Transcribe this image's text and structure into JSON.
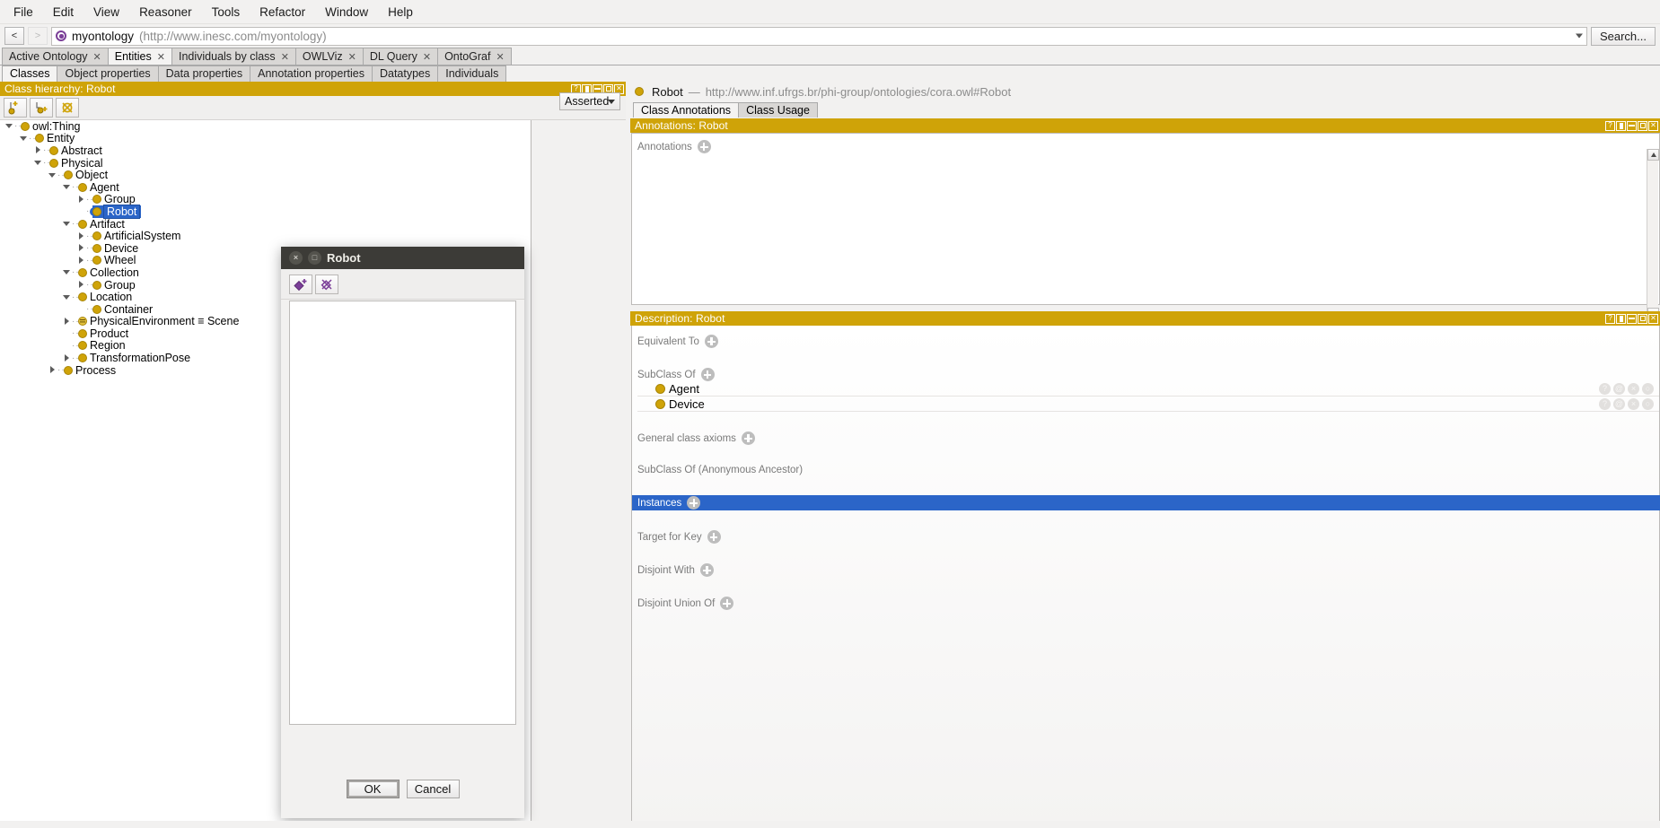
{
  "menubar": {
    "items": [
      {
        "label": "File"
      },
      {
        "label": "Edit"
      },
      {
        "label": "View"
      },
      {
        "label": "Reasoner"
      },
      {
        "label": "Tools"
      },
      {
        "label": "Refactor"
      },
      {
        "label": "Window"
      },
      {
        "label": "Help"
      }
    ]
  },
  "iribar": {
    "back_label": "<",
    "forward_label": ">",
    "ontology_name": "myontology",
    "ontology_iri": "(http://www.inesc.com/myontology)",
    "search_label": "Search...",
    "ontology_dot_color": "#7b3f98"
  },
  "workspace_tabs": [
    {
      "label": "Active Ontology",
      "active": false
    },
    {
      "label": "Entities",
      "active": true
    },
    {
      "label": "Individuals by class",
      "active": false
    },
    {
      "label": "OWLViz",
      "active": false
    },
    {
      "label": "DL Query",
      "active": false
    },
    {
      "label": "OntoGraf",
      "active": false
    }
  ],
  "category_tabs": [
    {
      "label": "Classes",
      "active": true
    },
    {
      "label": "Object properties",
      "active": false
    },
    {
      "label": "Data properties",
      "active": false
    },
    {
      "label": "Annotation properties",
      "active": false
    },
    {
      "label": "Datatypes",
      "active": false
    },
    {
      "label": "Individuals",
      "active": false
    }
  ],
  "class_hierarchy": {
    "title": "Class hierarchy: Robot",
    "toolbar": [
      {
        "name": "add-subclass-icon"
      },
      {
        "name": "add-sibling-class-icon"
      },
      {
        "name": "delete-class-icon"
      }
    ],
    "view_selector": "Asserted",
    "nodes": [
      {
        "label": "owl:Thing",
        "depth": 0,
        "twist": "down",
        "selected": false,
        "equivalent": false
      },
      {
        "label": "Entity",
        "depth": 1,
        "twist": "down",
        "selected": false,
        "equivalent": false
      },
      {
        "label": "Abstract",
        "depth": 2,
        "twist": "right",
        "selected": false,
        "equivalent": false
      },
      {
        "label": "Physical",
        "depth": 2,
        "twist": "down",
        "selected": false,
        "equivalent": false
      },
      {
        "label": "Object",
        "depth": 3,
        "twist": "down",
        "selected": false,
        "equivalent": false
      },
      {
        "label": "Agent",
        "depth": 4,
        "twist": "down",
        "selected": false,
        "equivalent": false
      },
      {
        "label": "Group",
        "depth": 5,
        "twist": "right",
        "selected": false,
        "equivalent": false
      },
      {
        "label": "Robot",
        "depth": 5,
        "twist": "leaf",
        "selected": true,
        "equivalent": false
      },
      {
        "label": "Artifact",
        "depth": 4,
        "twist": "down",
        "selected": false,
        "equivalent": false
      },
      {
        "label": "ArtificialSystem",
        "depth": 5,
        "twist": "right",
        "selected": false,
        "equivalent": false
      },
      {
        "label": "Device",
        "depth": 5,
        "twist": "right",
        "selected": false,
        "equivalent": false
      },
      {
        "label": "Wheel",
        "depth": 5,
        "twist": "right",
        "selected": false,
        "equivalent": false
      },
      {
        "label": "Collection",
        "depth": 4,
        "twist": "down",
        "selected": false,
        "equivalent": false
      },
      {
        "label": "Group",
        "depth": 5,
        "twist": "right",
        "selected": false,
        "equivalent": false
      },
      {
        "label": "Location",
        "depth": 4,
        "twist": "down",
        "selected": false,
        "equivalent": false
      },
      {
        "label": "Container",
        "depth": 5,
        "twist": "leaf",
        "selected": false,
        "equivalent": false
      },
      {
        "label": "PhysicalEnvironment ≡ Scene",
        "depth": 4,
        "twist": "right",
        "selected": false,
        "equivalent": true
      },
      {
        "label": "Product",
        "depth": 4,
        "twist": "leaf",
        "selected": false,
        "equivalent": false
      },
      {
        "label": "Region",
        "depth": 4,
        "twist": "leaf",
        "selected": false,
        "equivalent": false
      },
      {
        "label": "TransformationPose",
        "depth": 4,
        "twist": "right",
        "selected": false,
        "equivalent": false
      },
      {
        "label": "Process",
        "depth": 3,
        "twist": "right",
        "selected": false,
        "equivalent": false
      }
    ]
  },
  "entity_header": {
    "name": "Robot",
    "separator": "—",
    "iri": "http://www.inf.ufrgs.br/phi-group/ontologies/cora.owl#Robot"
  },
  "entity_tabs": [
    {
      "label": "Class Annotations",
      "active": true
    },
    {
      "label": "Class Usage",
      "active": false
    }
  ],
  "annotations_panel": {
    "title": "Annotations: Robot",
    "field_label": "Annotations"
  },
  "description_panel": {
    "title": "Description: Robot",
    "sections": [
      {
        "label": "Equivalent To",
        "has_add": true,
        "values": []
      },
      {
        "label": "SubClass Of",
        "has_add": true,
        "values": [
          "Agent",
          "Device"
        ]
      },
      {
        "label": "General class axioms",
        "has_add": true,
        "values": []
      },
      {
        "label": "SubClass Of (Anonymous Ancestor)",
        "has_add": false,
        "values": []
      }
    ],
    "instances_label": "Instances",
    "trailing_sections": [
      {
        "label": "Target for Key",
        "has_add": true
      },
      {
        "label": "Disjoint With",
        "has_add": true
      },
      {
        "label": "Disjoint Union Of",
        "has_add": true
      }
    ],
    "row_icons": [
      "?",
      "@",
      "×",
      "○"
    ]
  },
  "panel_controls": [
    "?",
    "split",
    "min",
    "max",
    "close"
  ],
  "modal": {
    "title": "Robot",
    "close_glyph": "×",
    "maximize_glyph": "□",
    "toolbar": [
      {
        "name": "add-individual-icon"
      },
      {
        "name": "delete-individual-icon"
      }
    ],
    "ok_label": "OK",
    "cancel_label": "Cancel"
  },
  "colors": {
    "panel_header": "#cfa308",
    "selection_blue": "#2b65c8",
    "class_dot": "#cfa308",
    "ontology_purple": "#7b3f98"
  }
}
